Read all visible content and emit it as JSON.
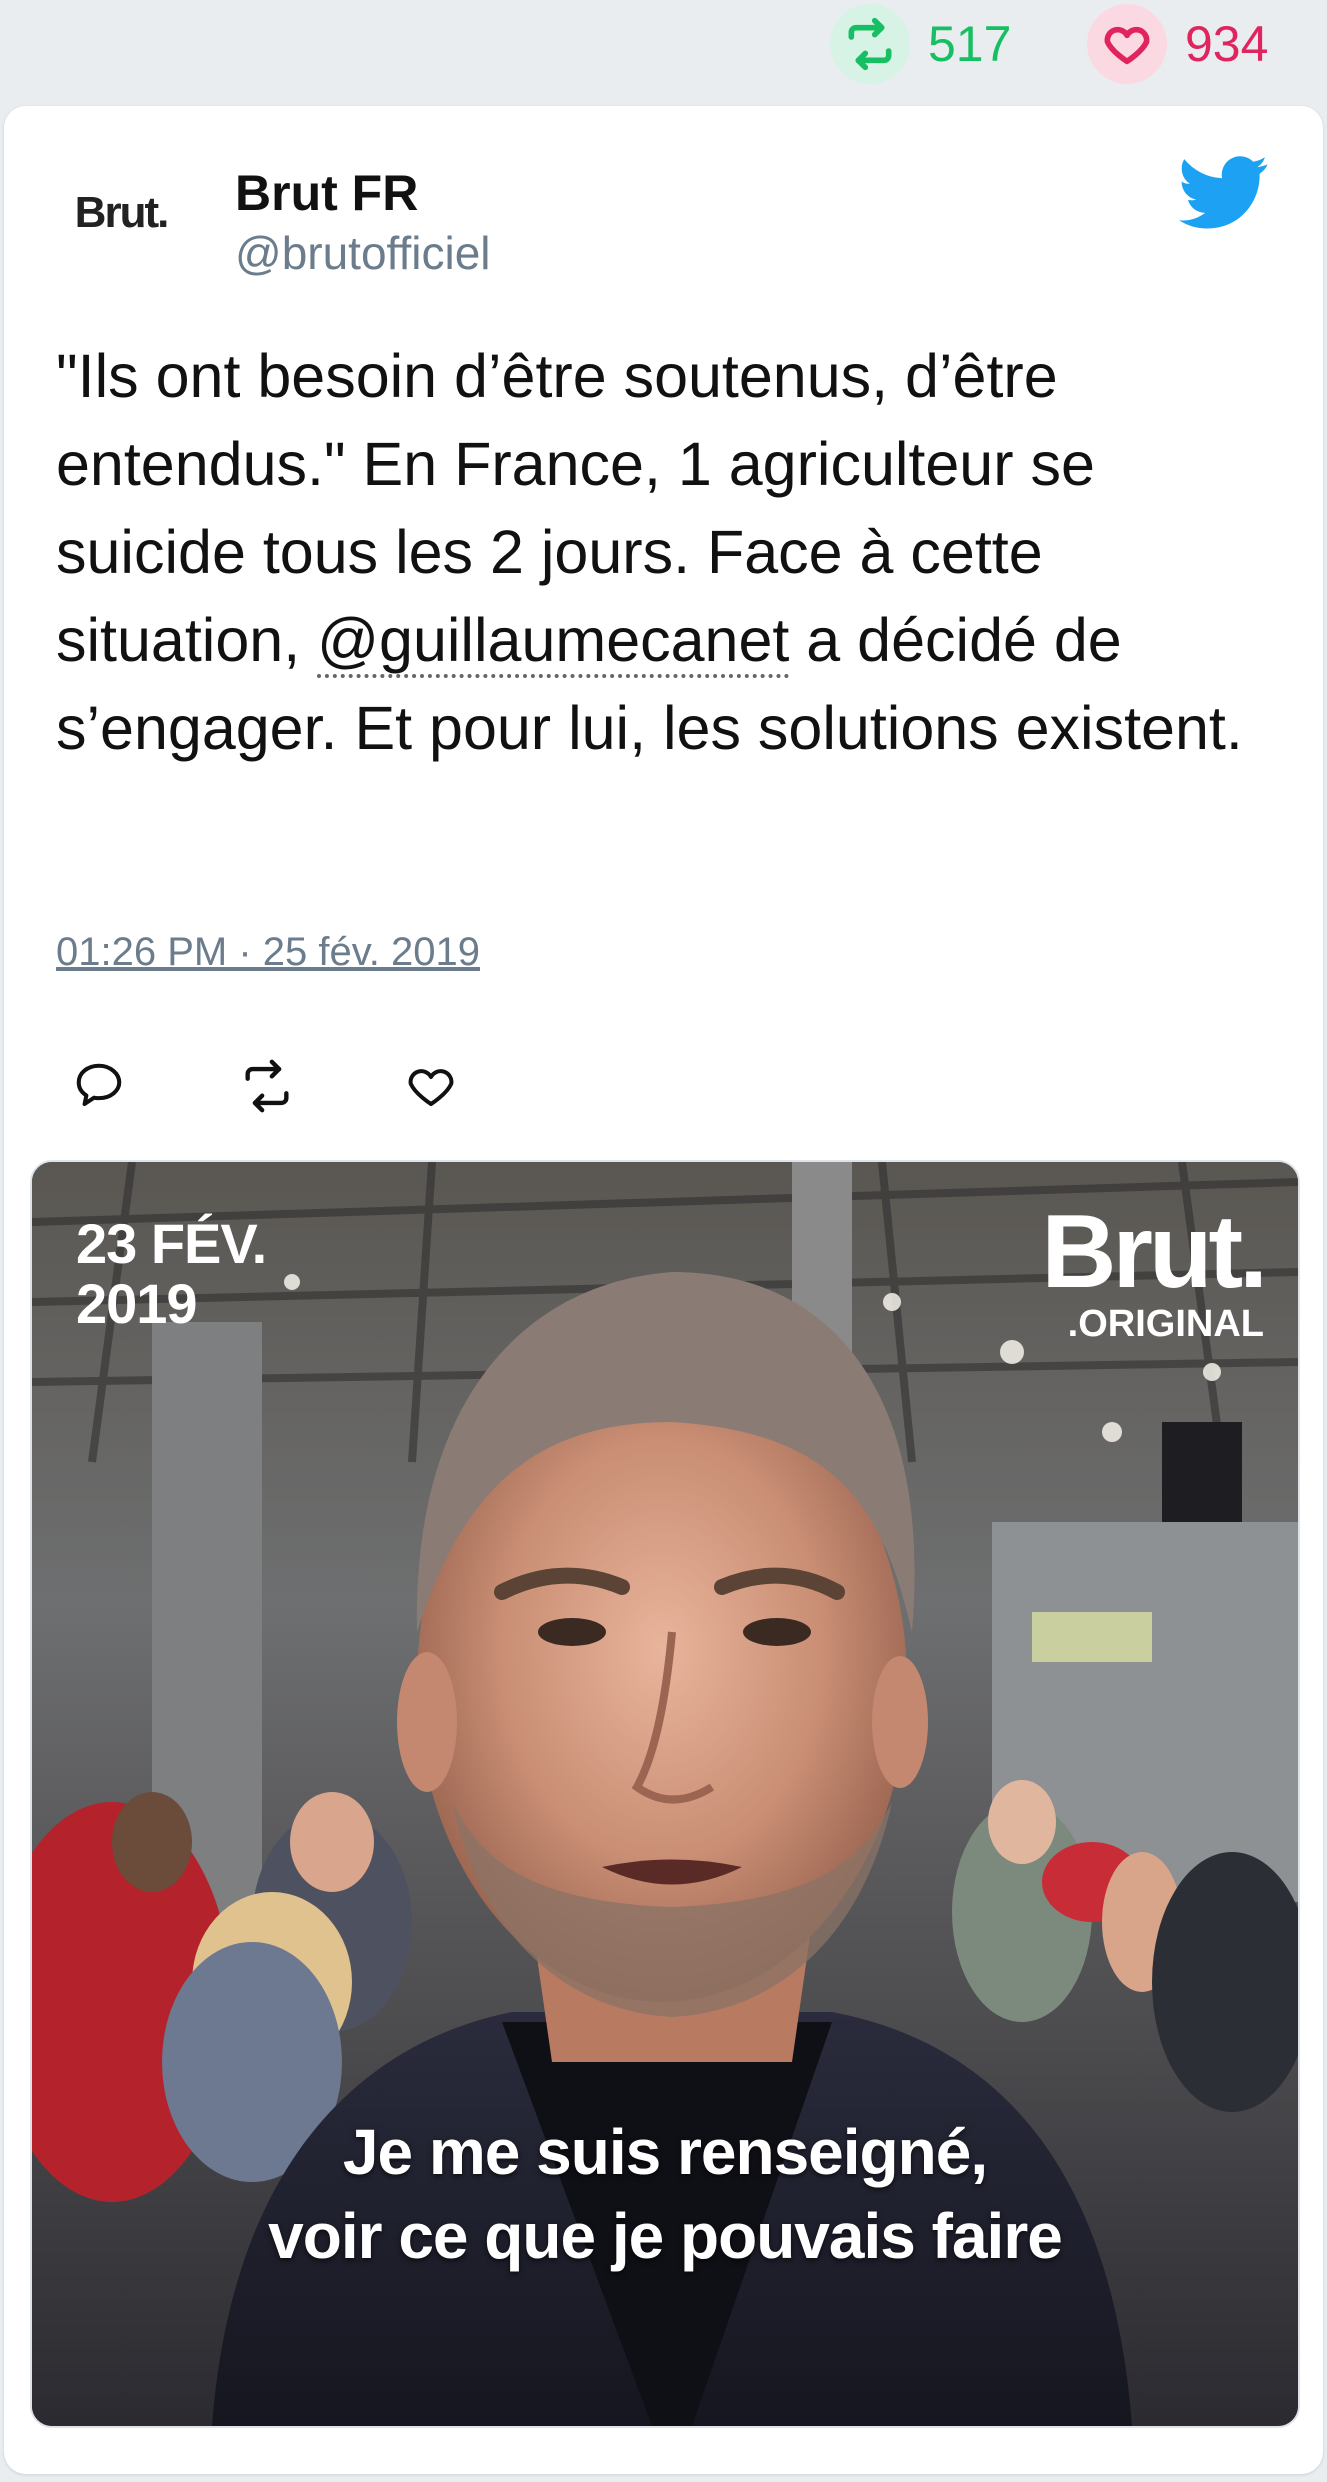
{
  "stats": {
    "retweet_count": "517",
    "like_count": "934"
  },
  "tweet": {
    "avatar_text": "Brut.",
    "author_name": "Brut FR",
    "author_handle": "@brutofficiel",
    "text_before": "\"Ils ont besoin d’être soutenus, d’être entendus.\" En France, 1 agriculteur se suicide tous les 2 jours. Face à cette situation, ",
    "mention": "@guillaumecanet",
    "text_after": " a décidé de s’engager. Et pour lui, les solutions existent.",
    "timestamp": "01:26 PM · 25 fév. 2019"
  },
  "media": {
    "date_overlay": "23 FÉV.\n2019",
    "logo_main": "Brut.",
    "logo_sub": ".ORIGINAL",
    "subtitle_line1": "Je me suis renseigné,",
    "subtitle_line2": "voir ce que je pouvais faire"
  },
  "icons": {
    "retweet": "retweet-icon",
    "like": "heart-icon",
    "reply": "reply-icon",
    "brand": "twitter-bird-icon"
  },
  "colors": {
    "retweet": "#17bf63",
    "like": "#e0245e",
    "twitter_blue": "#1da1f2",
    "handle_gray": "#6b7c8c"
  }
}
